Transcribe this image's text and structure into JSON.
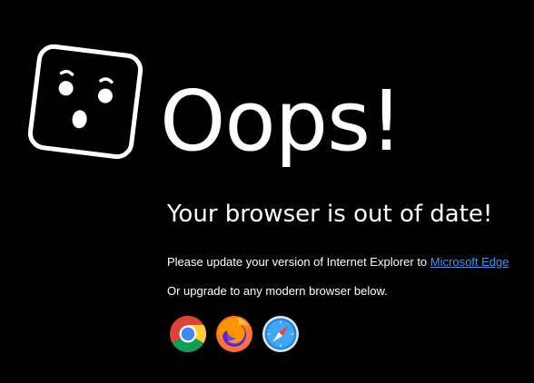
{
  "headline": "Oops!",
  "subheading": "Your browser is out of date!",
  "update_message": {
    "prefix": "Please update your version of Internet Explorer to",
    "link_label": "Microsoft Edge"
  },
  "upgrade_message": "Or upgrade to any modern browser below.",
  "browsers": [
    {
      "icon": "chrome-icon"
    },
    {
      "icon": "firefox-icon"
    },
    {
      "icon": "safari-icon"
    }
  ],
  "colors": {
    "background": "#000000",
    "text": "#ffffff",
    "link": "#4a90e2"
  }
}
